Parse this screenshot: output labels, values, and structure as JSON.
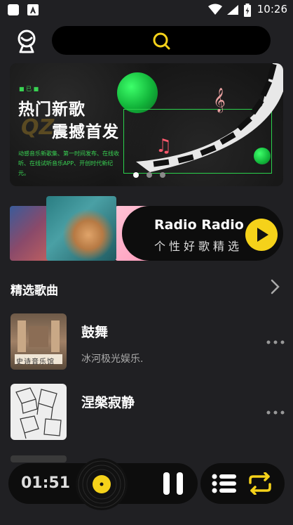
{
  "status_bar": {
    "time": "10:26"
  },
  "header": {
    "logo_icon": "qz-logo-icon",
    "search_icon": "search-icon"
  },
  "banner": {
    "small_label": "■ 已 ■",
    "title_line1": "热门新歌",
    "title_line2": "震撼首发",
    "brand": "QZ",
    "description": "动感音乐新歌集、第一时间发布、在线收听、在线试听音乐APP、开创时代新纪元。",
    "dots": 3,
    "active_dot": 0,
    "accent": "#2bd24c"
  },
  "radio": {
    "title": "Radio Radio",
    "subtitle": "个性好歌精选",
    "play_icon": "play-icon",
    "accent": "#f5d21a"
  },
  "featured": {
    "title": "精选歌曲",
    "more_icon": "chevron-right-icon",
    "songs": [
      {
        "title": "鼓舞",
        "artist": "冰河极光娱乐.",
        "cover_text": "史诗音乐馆"
      },
      {
        "title": "涅槃寂静",
        "artist": ""
      }
    ]
  },
  "player": {
    "time": "01:51",
    "pause_icon": "pause-icon",
    "playlist_icon": "playlist-icon",
    "repeat_icon": "repeat-icon"
  }
}
